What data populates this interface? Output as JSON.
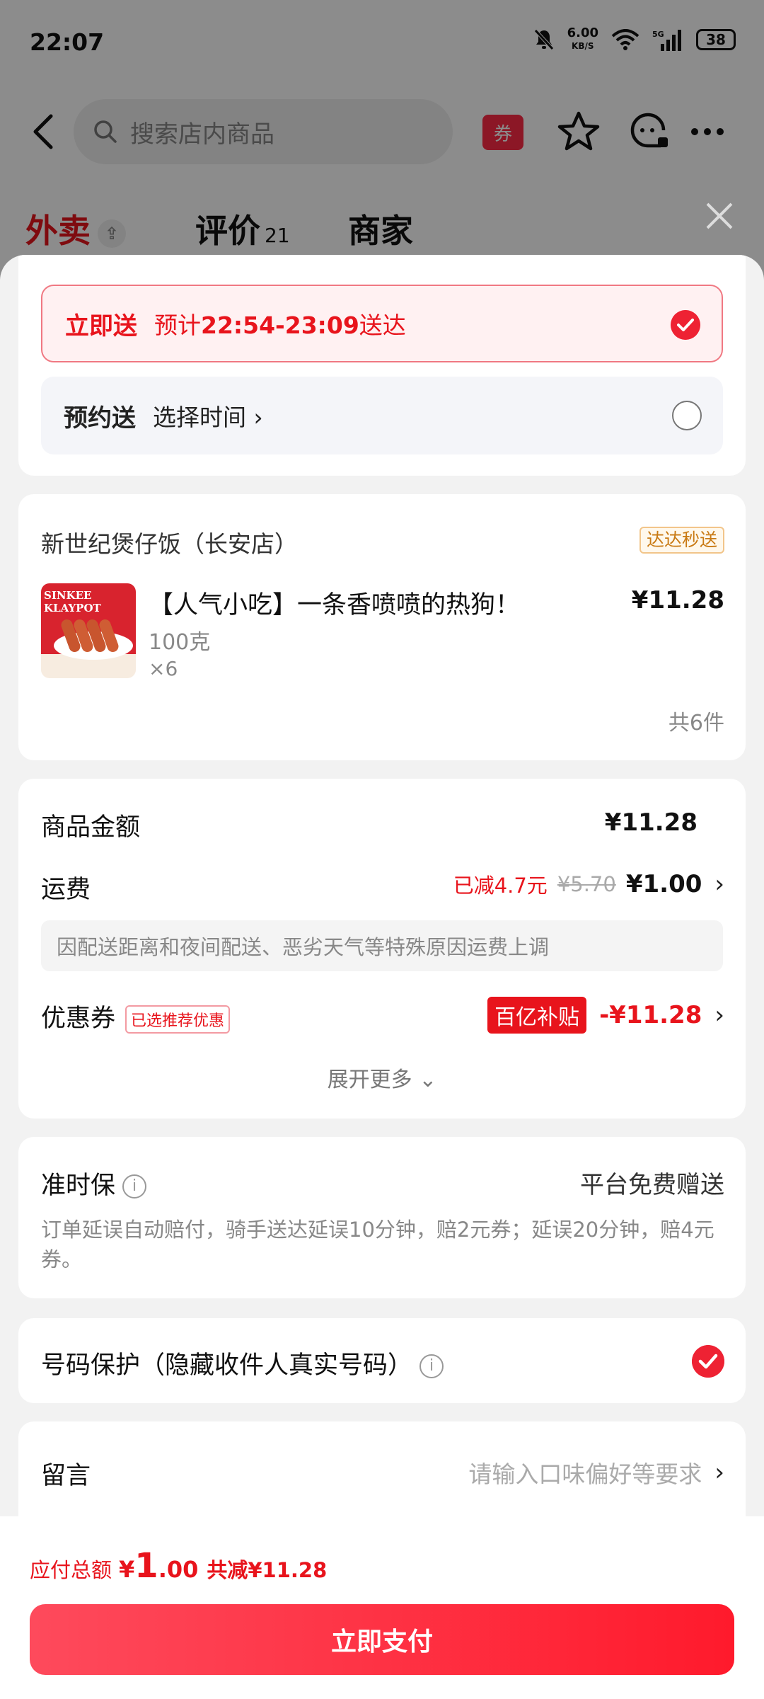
{
  "status": {
    "time": "22:07",
    "net_speed": "6.00",
    "net_unit": "KB/S",
    "signal": "5G",
    "battery": "38"
  },
  "header": {
    "search_placeholder": "搜索店内商品",
    "coupon_tag": "券"
  },
  "store_tabs": [
    {
      "label": "外卖",
      "active": true
    },
    {
      "label": "评价",
      "count": "21"
    },
    {
      "label": "商家"
    }
  ],
  "delivery": {
    "now": {
      "title": "立即送",
      "prefix": "预计",
      "time": "22:54-23:09",
      "suffix": "送达",
      "selected": true
    },
    "scheduled": {
      "title": "预约送",
      "sub": "选择时间 ›",
      "selected": false
    }
  },
  "store": {
    "name": "新世纪煲仔饭（长安店）",
    "tag": "达达秒送",
    "item": {
      "image_text": [
        "SINKEE",
        "KLAYPOT"
      ],
      "title": "【人气小吃】一条香喷喷的热狗！",
      "weight": "100克",
      "qty": "×6",
      "price": "¥11.28"
    },
    "total_items": "共6件"
  },
  "fees": {
    "goods_label": "商品金额",
    "goods_amount": "¥11.28",
    "shipping_label": "运费",
    "shipping_reduced": "已减4.7元",
    "shipping_original": "¥5.70",
    "shipping_amount": "¥1.00",
    "shipping_note": "因配送距离和夜间配送、恶劣天气等特殊原因运费上调",
    "coupon_label": "优惠券",
    "coupon_tag": "已选推荐优惠",
    "coupon_subsidy": "百亿补贴",
    "coupon_amount": "-¥11.28",
    "expand": "展开更多"
  },
  "ontime": {
    "label": "准时保",
    "right": "平台免费赠送",
    "desc": "订单延误自动赔付，骑手送达延误10分钟，赔2元券；延误20分钟，赔4元券。"
  },
  "privacy": {
    "label": "号码保护（隐藏收件人真实号码）",
    "checked": true
  },
  "message": {
    "label": "留言",
    "placeholder": "请输入口味偏好等要求"
  },
  "footer": {
    "total_label": "应付总额",
    "yen": "¥",
    "amount_int": "1",
    "amount_dec": ".00",
    "saved": "共减¥11.28",
    "pay_button": "立即支付"
  },
  "colors": {
    "accent": "#e8141c",
    "pay_start": "#fe4a5c",
    "pay_end": "#ff1a2c"
  }
}
